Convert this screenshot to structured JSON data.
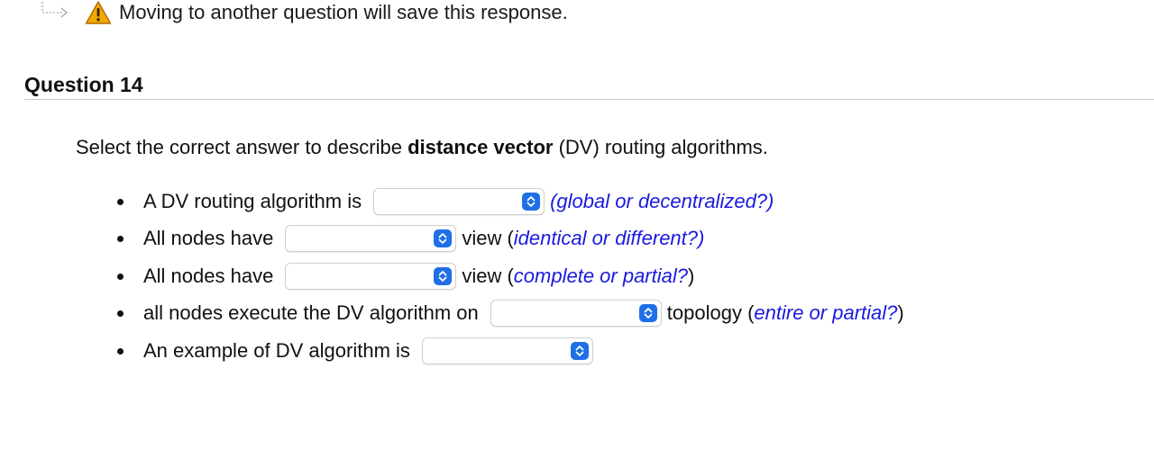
{
  "notice": {
    "text": "Moving to another question will save this response."
  },
  "question": {
    "title": "Question 14",
    "prompt_pre": "Select the correct answer to describe ",
    "prompt_bold": "distance vector",
    "prompt_post": " (DV) routing algorithms."
  },
  "items": [
    {
      "before": "A DV routing algorithm is",
      "after_plain_open": "",
      "hint": "(global or decentralized?)",
      "after_plain_close": "",
      "selected": ""
    },
    {
      "before": "All nodes have",
      "after_plain_open": "view (",
      "hint": "identical or different?)",
      "after_plain_close": "",
      "selected": ""
    },
    {
      "before": "All nodes have",
      "after_plain_open": "view (",
      "hint": "complete or partial?",
      "after_plain_close": ")",
      "selected": ""
    },
    {
      "before": "all nodes execute the DV algorithm on",
      "after_plain_open": "topology (",
      "hint": "entire or partial?",
      "after_plain_close": ")",
      "selected": ""
    },
    {
      "before": "An example of DV algorithm is",
      "after_plain_open": "",
      "hint": "",
      "after_plain_close": "",
      "selected": ""
    }
  ],
  "colors": {
    "hint": "#1a1ae0",
    "select_chevron": "#1f6fe6",
    "warning": "#f2a900"
  },
  "icons": {
    "notice_arrow": "return-arrow-icon",
    "notice_warning": "warning-icon",
    "select": "chevron-updown-icon"
  }
}
